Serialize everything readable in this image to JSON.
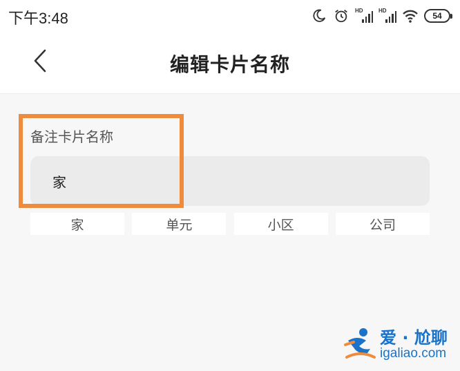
{
  "status_bar": {
    "time": "下午3:48",
    "network_badge": "HD",
    "battery_level": "54",
    "icons": [
      "moon-icon",
      "alarm-icon",
      "signal-hd-icon",
      "signal-hd-icon",
      "wifi-icon",
      "battery-icon"
    ]
  },
  "nav": {
    "title": "编辑卡片名称",
    "back_icon": "chevron-left-icon"
  },
  "form": {
    "label": "备注卡片名称",
    "input_value": "家"
  },
  "suggestions": [
    {
      "label": "家"
    },
    {
      "label": "单元"
    },
    {
      "label": "小区"
    },
    {
      "label": "公司"
    }
  ],
  "watermark": {
    "top": "爱 · 尬聊",
    "bottom": "igaliao.com"
  },
  "colors": {
    "highlight": "#ef8b3c",
    "watermark": "#1a73c9"
  }
}
